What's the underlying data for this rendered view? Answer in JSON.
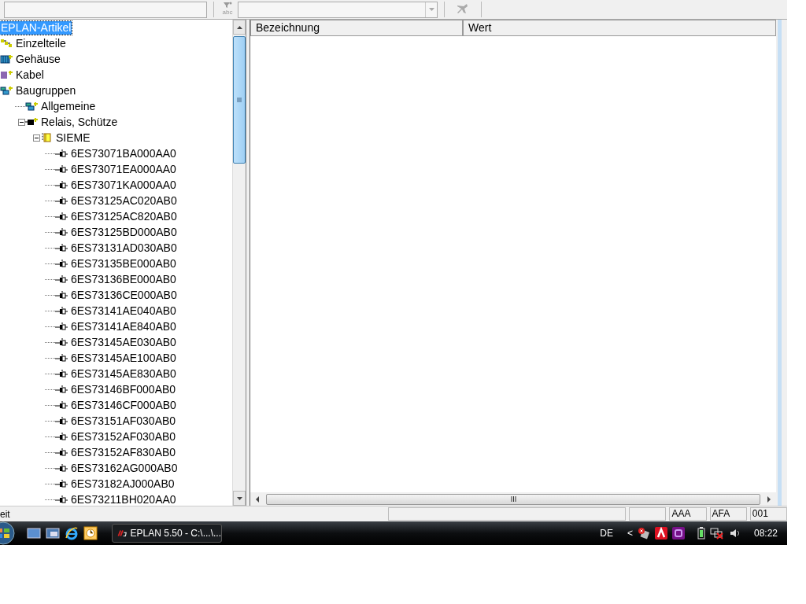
{
  "toolbar": {
    "filter_label": "abc"
  },
  "tree": {
    "label": "EPLAN-Artikel",
    "selected": true,
    "children": [
      {
        "label": "Einzelteile",
        "kind": "parts",
        "selected": false
      },
      {
        "label": "Gehäuse",
        "kind": "housing",
        "selected": false
      },
      {
        "label": "Kabel",
        "kind": "cable",
        "selected": false
      },
      {
        "label": "Baugruppen",
        "kind": "assembly",
        "selected": false,
        "children": [
          {
            "label": "Allgemeine",
            "kind": "assembly",
            "selected": false
          },
          {
            "label": "Relais, Schütze",
            "kind": "relay",
            "selected": false,
            "expanded": true,
            "children": [
              {
                "label": "SIEME",
                "kind": "manufacturer",
                "selected": false,
                "expanded": true,
                "children": [
                  {
                    "label": "6ES73071BA000AA0",
                    "kind": "article",
                    "selected": false
                  },
                  {
                    "label": "6ES73071EA000AA0",
                    "kind": "article",
                    "selected": false
                  },
                  {
                    "label": "6ES73071KA000AA0",
                    "kind": "article",
                    "selected": false
                  },
                  {
                    "label": "6ES73125AC020AB0",
                    "kind": "article",
                    "selected": false
                  },
                  {
                    "label": "6ES73125AC820AB0",
                    "kind": "article",
                    "selected": false
                  },
                  {
                    "label": "6ES73125BD000AB0",
                    "kind": "article",
                    "selected": false
                  },
                  {
                    "label": "6ES73131AD030AB0",
                    "kind": "article",
                    "selected": false
                  },
                  {
                    "label": "6ES73135BE000AB0",
                    "kind": "article",
                    "selected": false
                  },
                  {
                    "label": "6ES73136BE000AB0",
                    "kind": "article",
                    "selected": false
                  },
                  {
                    "label": "6ES73136CE000AB0",
                    "kind": "article",
                    "selected": false
                  },
                  {
                    "label": "6ES73141AE040AB0",
                    "kind": "article",
                    "selected": false
                  },
                  {
                    "label": "6ES73141AE840AB0",
                    "kind": "article",
                    "selected": false
                  },
                  {
                    "label": "6ES73145AE030AB0",
                    "kind": "article",
                    "selected": false
                  },
                  {
                    "label": "6ES73145AE100AB0",
                    "kind": "article",
                    "selected": false
                  },
                  {
                    "label": "6ES73145AE830AB0",
                    "kind": "article",
                    "selected": false
                  },
                  {
                    "label": "6ES73146BF000AB0",
                    "kind": "article",
                    "selected": false
                  },
                  {
                    "label": "6ES73146CF000AB0",
                    "kind": "article",
                    "selected": false
                  },
                  {
                    "label": "6ES73151AF030AB0",
                    "kind": "article",
                    "selected": false
                  },
                  {
                    "label": "6ES73152AF030AB0",
                    "kind": "article",
                    "selected": false
                  },
                  {
                    "label": "6ES73152AF830AB0",
                    "kind": "article",
                    "selected": false
                  },
                  {
                    "label": "6ES73162AG000AB0",
                    "kind": "article",
                    "selected": false
                  },
                  {
                    "label": "6ES73182AJ000AB0",
                    "kind": "article",
                    "selected": false
                  },
                  {
                    "label": "6ES73211BH020AA0",
                    "kind": "article",
                    "selected": false
                  }
                ]
              }
            ]
          }
        ]
      }
    ]
  },
  "table": {
    "columns": [
      "Bezeichnung",
      "Wert"
    ]
  },
  "status_bar": {
    "message": "eit",
    "fields": [
      "AAA",
      "AFA",
      "001"
    ]
  },
  "taskbar": {
    "task": "EPLAN 5.50 - C:\\...\\...",
    "language": "DE",
    "tray_expander": "<",
    "clock": "08:22"
  }
}
